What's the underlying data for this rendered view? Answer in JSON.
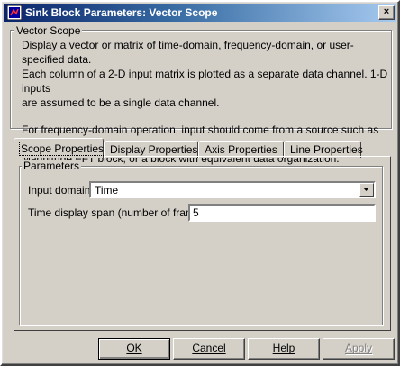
{
  "window": {
    "title": "Sink Block Parameters: Vector Scope",
    "close_glyph": "×",
    "icon": "simulink-block-icon"
  },
  "description_group": {
    "legend": "Vector Scope",
    "paragraph1_line1": "Display a vector or matrix of time-domain, frequency-domain, or user-specified data.",
    "paragraph1_line2": "Each column of a 2-D input matrix is plotted as a separate data channel.  1-D inputs",
    "paragraph1_line3": "are assumed to be a single data channel.",
    "paragraph2_line1": "For frequency-domain operation, input should come from a source such as the",
    "paragraph2_line2": "Magnitude FFT block, or a block with equivalent data organization."
  },
  "tabs": [
    {
      "label": "Scope Properties",
      "active": true
    },
    {
      "label": "Display Properties",
      "active": false
    },
    {
      "label": "Axis Properties",
      "active": false
    },
    {
      "label": "Line Properties",
      "active": false
    }
  ],
  "parameters": {
    "legend": "Parameters",
    "input_domain_label": "Input domain:",
    "input_domain_value": "Time",
    "time_span_label": "Time display span (number of frames):",
    "time_span_value": "5"
  },
  "buttons": {
    "ok": "OK",
    "cancel": "Cancel",
    "help": "Help",
    "apply": "Apply"
  }
}
